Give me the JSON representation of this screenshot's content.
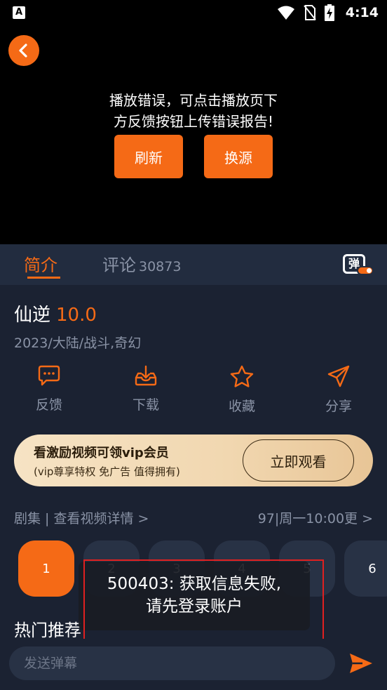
{
  "status_bar": {
    "app_badge": "A",
    "time": "4:14"
  },
  "player": {
    "error_line1": "播放错误，可点击播放页下",
    "error_line2": "方反馈按钮上传错误报告!",
    "refresh_label": "刷新",
    "switch_source_label": "换源"
  },
  "tabs": {
    "intro": "简介",
    "comments": "评论",
    "comments_count": "30873",
    "danmu_char": "弹"
  },
  "info": {
    "title": "仙逆",
    "score": "10.0",
    "meta": "2023/大陆/战斗,奇幻"
  },
  "actions": [
    {
      "label": "反馈",
      "icon": "feedback-icon"
    },
    {
      "label": "下载",
      "icon": "download-icon"
    },
    {
      "label": "收藏",
      "icon": "star-icon"
    },
    {
      "label": "分享",
      "icon": "share-icon"
    }
  ],
  "vip": {
    "title": "看激励视频可领vip会员",
    "subtitle": "(vip尊享特权 免广告 值得拥有)",
    "button": "立即观看"
  },
  "episodes": {
    "header_left": "剧集 | 查看视频详情 >",
    "header_right": "97|周一10:00更 >",
    "items": [
      "1",
      "2",
      "3",
      "4",
      "5",
      "6"
    ]
  },
  "hot": {
    "title": "热门推荐"
  },
  "toast": {
    "line1": "500403: 获取信息失败,",
    "line2": "请先登录账户"
  },
  "danmu_input": {
    "placeholder": "发送弹幕"
  },
  "colors": {
    "accent": "#f56a16",
    "background": "#1b2232",
    "tab_bg": "#222c3f",
    "muted": "#8a93a6"
  }
}
